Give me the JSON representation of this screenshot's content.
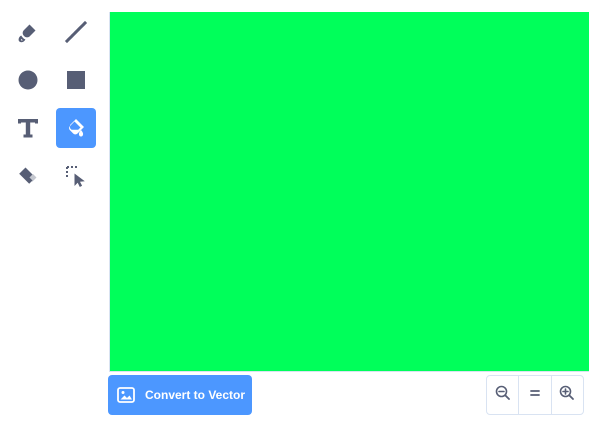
{
  "toolbox": {
    "tools": [
      {
        "name": "brush",
        "icon": "brush-icon",
        "active": false
      },
      {
        "name": "line",
        "icon": "line-icon",
        "active": false
      },
      {
        "name": "circle",
        "icon": "circle-icon",
        "active": false
      },
      {
        "name": "rectangle",
        "icon": "rectangle-icon",
        "active": false
      },
      {
        "name": "text",
        "icon": "text-icon",
        "active": false
      },
      {
        "name": "fill",
        "icon": "fill-icon",
        "active": true
      },
      {
        "name": "eraser",
        "icon": "eraser-icon",
        "active": false
      },
      {
        "name": "select",
        "icon": "select-icon",
        "active": false
      }
    ]
  },
  "canvas": {
    "fill_color": "#00ff5a"
  },
  "actions": {
    "convert_label": "Convert to Vector"
  },
  "zoom": {
    "buttons": [
      "zoom-out",
      "reset-zoom",
      "zoom-in"
    ]
  },
  "colors": {
    "accent": "#4c97ff",
    "icon": "#575e75",
    "border": "#d9e3f2"
  }
}
